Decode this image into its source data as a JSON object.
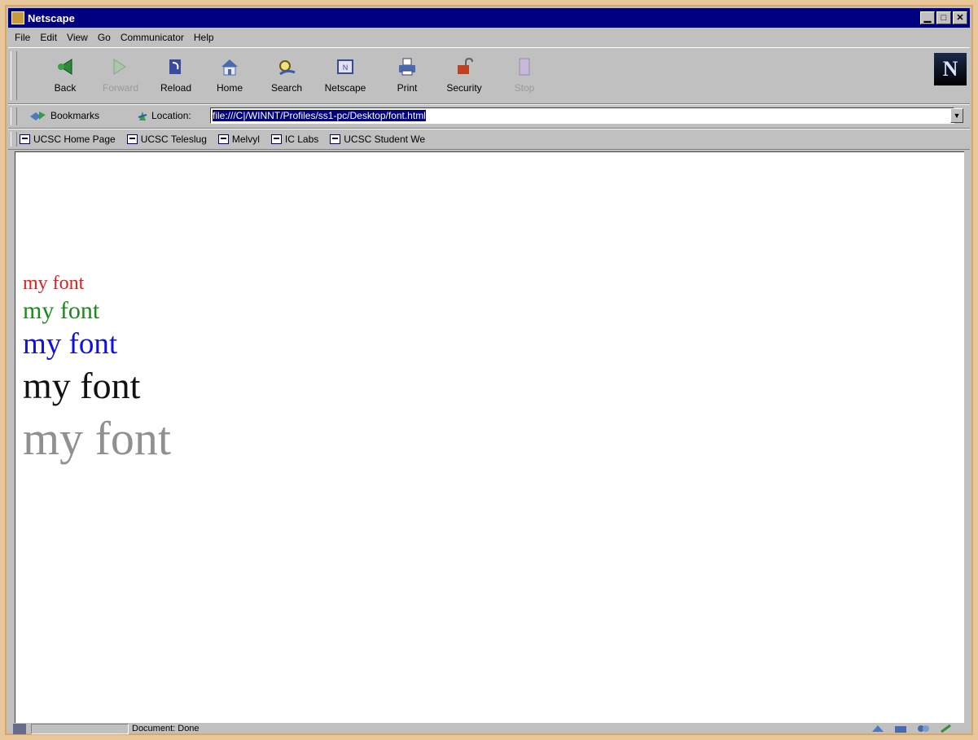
{
  "window": {
    "title": "Netscape"
  },
  "menu": [
    {
      "label": "File"
    },
    {
      "label": "Edit"
    },
    {
      "label": "View"
    },
    {
      "label": "Go"
    },
    {
      "label": "Communicator"
    },
    {
      "label": "Help"
    }
  ],
  "toolbar": {
    "back": "Back",
    "forward": "Forward",
    "reload": "Reload",
    "home": "Home",
    "search": "Search",
    "netscape": "Netscape",
    "print": "Print",
    "security": "Security",
    "stop": "Stop"
  },
  "location": {
    "bookmarks_label": "Bookmarks",
    "location_label": "Location:",
    "url": "file:///C|/WINNT/Profiles/ss1-pc/Desktop/font.html"
  },
  "links": [
    {
      "label": "UCSC Home Page"
    },
    {
      "label": "UCSC Teleslug"
    },
    {
      "label": "Melvyl"
    },
    {
      "label": "IC Labs"
    },
    {
      "label": "UCSC Student We"
    }
  ],
  "content": {
    "lines": [
      {
        "text": "my font",
        "color": "#e02020"
      },
      {
        "text": "my font",
        "color": "#1a8a1a"
      },
      {
        "text": "my font",
        "color": "#1010e0"
      },
      {
        "text": "my font",
        "color": "#111111"
      },
      {
        "text": "my font",
        "color": "#909090"
      }
    ]
  },
  "status": {
    "text": "Document: Done"
  }
}
